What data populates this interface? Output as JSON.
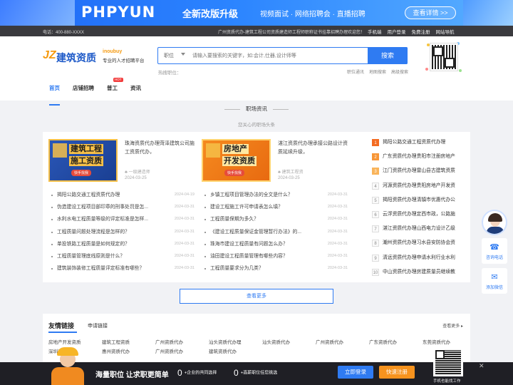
{
  "banner": {
    "brand": "PHPYUN",
    "headline": "全新改版升级",
    "subline": "视频面试 · 网络招聘会 · 直播招聘",
    "cta": "查看详情 >>"
  },
  "topbar": {
    "phone": "电话：400-880-XXXX",
    "notice": "广州资质代办-建筑工程公司资质建造师工程师职称证书挂靠招聘办理欢迎您！",
    "links": [
      "手机端",
      "用户登录",
      "免费注册",
      "网站导航"
    ]
  },
  "header": {
    "logo_jz": "JZ",
    "logo_main": "建筑资质",
    "logo_en": "inoubuy",
    "logo_slogan": "专业的人才招聘平台",
    "search_category": "职位",
    "search_placeholder": "请输入要搜索的关键字，如:会计,仕器,设计师等",
    "search_button": "搜索",
    "hot_label": "热搜职位：",
    "search_extras": [
      "职位通讯",
      "地图搜索",
      "高级搜索"
    ]
  },
  "nav": {
    "items": [
      "首页",
      "店铺招聘",
      "普工",
      "资讯"
    ],
    "hot_badge": "HOT"
  },
  "section": {
    "title": "职场资讯",
    "subtitle": "您关心的职场头条"
  },
  "featured": [
    {
      "img_line1": "建筑工程",
      "img_line2": "施工资质",
      "img_tag": "快手找我",
      "title": "珠海资质代办理菏泽建筑公司施工资质代办，",
      "meta": "一级建造师",
      "date": "2024-03-25"
    },
    {
      "img_line1": "房地产",
      "img_line2": "开发资质",
      "img_tag": "快手找我",
      "title": "湛江资质代办理承接公路设计资质延续升级，",
      "meta": "建筑工程资",
      "date": "2024-03-25"
    }
  ],
  "news_left": [
    {
      "title": "揭阳公路交通工程资质代办理",
      "date": "2024-04-19"
    },
    {
      "title": "伪造建设工程项目部印章的刑事处罚是怎...",
      "date": "2024-03-31"
    },
    {
      "title": "水利水电工程质量等级的评定标准是怎样...",
      "date": "2024-03-31"
    },
    {
      "title": "工程质量问题处理流程是怎样的？",
      "date": "2024-03-31"
    },
    {
      "title": "单投铁路工程质量是如何规定的？",
      "date": "2024-03-31"
    },
    {
      "title": "工程质量管理底线原则是什么？",
      "date": "2024-03-31"
    },
    {
      "title": "建筑装饰装修工程质量评定标准有哪些？",
      "date": "2024-03-31"
    }
  ],
  "news_right": [
    {
      "title": "乡镇工程项目管理办法的全文是什么？",
      "date": "2024-03-31"
    },
    {
      "title": "建设工程施工许可申请表怎么填？",
      "date": "2024-03-31"
    },
    {
      "title": "工程质量保期为多久？",
      "date": "2024-03-31"
    },
    {
      "title": "《建设工程质量保证金管理暂行办法》的...",
      "date": "2024-03-31"
    },
    {
      "title": "珠海市建设工程质量有问题怎么办？",
      "date": "2024-03-31"
    },
    {
      "title": "油田建设工程质量管理有哪些内容？",
      "date": "2024-03-31"
    },
    {
      "title": "工程质量要求分为几类？",
      "date": "2024-03-31"
    }
  ],
  "ranking": [
    "揭阳公路交通工程资质代办理",
    "广东资质代办理贵阳市注册房地产",
    "江门资质代办理雷山县古建筑资质",
    "河源资质代办理贵阳房地产开发资",
    "揭阳资质代办理清镇市优惠代办公",
    "云浮资质代办理定西市政，公路施",
    "湛江资质代办理山西电力设计乙级",
    "潮州资质代办理习水县安防协会资",
    "清远资质代办理申请水利行业水利",
    "中山资质代办理房建质量员继续教"
  ],
  "more_button": "查看更多",
  "links_panel": {
    "title": "友情链接",
    "apply": "申请链接",
    "more": "查看更多",
    "items": [
      "房地产开发资质",
      "建筑工程资质",
      "广州资质代办",
      "汕头资质代办理",
      "汕头资质代办",
      "广州资质代办",
      "广东资质代办",
      "东莞资质代办",
      "深圳资质代办",
      "惠州资质代办",
      "广州资质代办",
      "建筑资质代办"
    ]
  },
  "float": {
    "consult": "咨询电话",
    "wechat": "添加微信"
  },
  "bottom_bar": {
    "headline": "海量职位 让求职更简单",
    "stat1_value": "0",
    "stat1_label": "+企业的共同选择",
    "stat2_value": "0",
    "stat2_label": "+高薪职位任您挑选",
    "login": "立即登录",
    "register": "快速注册",
    "qr_caption": "手机也能找工作",
    "close": "✕"
  }
}
